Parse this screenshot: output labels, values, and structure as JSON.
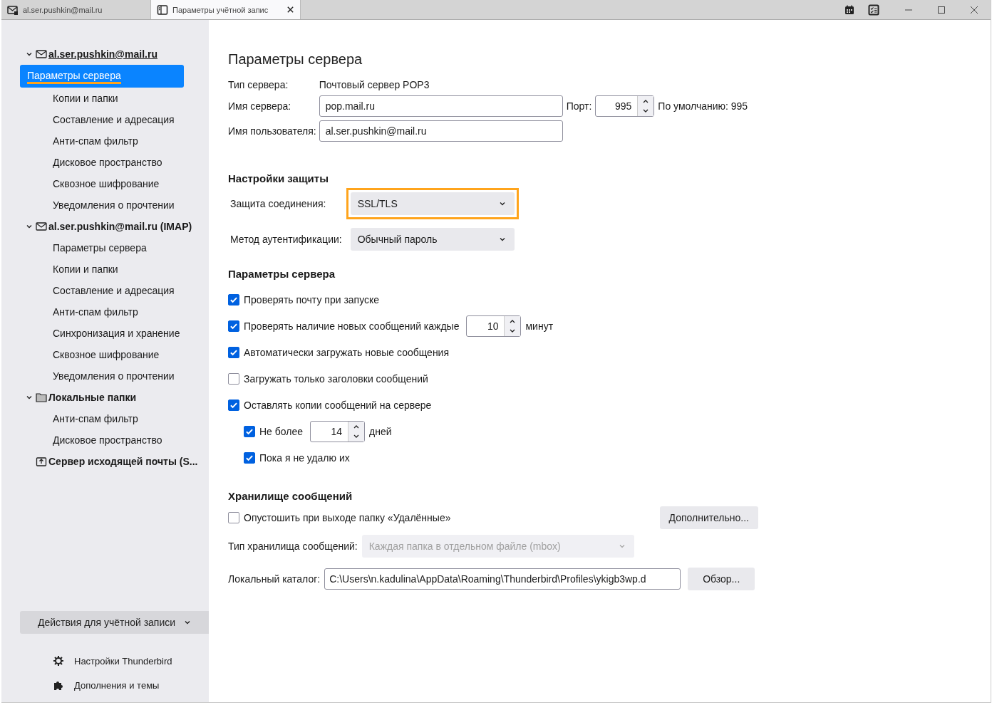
{
  "tabs": [
    {
      "label": "al.ser.pushkin@mail.ru",
      "selected": false
    },
    {
      "label": "Параметры учётной запис",
      "selected": true
    }
  ],
  "sidebar": {
    "accounts": [
      {
        "label": "al.ser.pushkin@mail.ru",
        "kind": "mail",
        "expanded": true,
        "underlined": true,
        "children": [
          {
            "label": "Параметры сервера",
            "selected": true,
            "highlighted": true
          },
          {
            "label": "Копии и папки",
            "selected": false,
            "highlighted": false
          },
          {
            "label": "Составление и адресация",
            "selected": false,
            "highlighted": false
          },
          {
            "label": "Анти-спам фильтр",
            "selected": false,
            "highlighted": false
          },
          {
            "label": "Дисковое пространство",
            "selected": false,
            "highlighted": false
          },
          {
            "label": "Сквозное шифрование",
            "selected": false,
            "highlighted": false
          },
          {
            "label": "Уведомления о прочтении",
            "selected": false,
            "highlighted": false
          }
        ]
      },
      {
        "label": "al.ser.pushkin@mail.ru (IMAP)",
        "kind": "mail",
        "expanded": true,
        "underlined": false,
        "children": [
          {
            "label": "Параметры сервера",
            "selected": false,
            "highlighted": false
          },
          {
            "label": "Копии и папки",
            "selected": false,
            "highlighted": false
          },
          {
            "label": "Составление и адресация",
            "selected": false,
            "highlighted": false
          },
          {
            "label": "Анти-спам фильтр",
            "selected": false,
            "highlighted": false
          },
          {
            "label": "Синхронизация и хранение",
            "selected": false,
            "highlighted": false
          },
          {
            "label": "Сквозное шифрование",
            "selected": false,
            "highlighted": false
          },
          {
            "label": "Уведомления о прочтении",
            "selected": false,
            "highlighted": false
          }
        ]
      },
      {
        "label": "Локальные папки",
        "kind": "folder",
        "expanded": true,
        "underlined": false,
        "children": [
          {
            "label": "Анти-спам фильтр",
            "selected": false,
            "highlighted": false
          },
          {
            "label": "Дисковое пространство",
            "selected": false,
            "highlighted": false
          }
        ]
      },
      {
        "label": "Сервер исходящей почты (S...",
        "kind": "outgoing",
        "underlined": false
      }
    ],
    "actions_button": "Действия для учётной записи",
    "footer": [
      {
        "label": "Настройки Thunderbird",
        "kind": "gear"
      },
      {
        "label": "Дополнения и темы",
        "kind": "puzzle"
      }
    ]
  },
  "main": {
    "title": "Параметры сервера",
    "server_type_label": "Тип сервера:",
    "server_type": "Почтовый сервер POP3",
    "server_name_label": "Имя сервера:",
    "server_name": "pop.mail.ru",
    "port_label": "Порт:",
    "port": "995",
    "default_port": "По умолчанию: 995",
    "username_label": "Имя пользователя:",
    "username": "al.ser.pushkin@mail.ru",
    "security": {
      "heading": "Настройки защиты",
      "rows": [
        {
          "label": "Защита соединения:",
          "value": "SSL/TLS",
          "highlighted": true
        },
        {
          "label": "Метод аутентификации:",
          "value": "Обычный пароль",
          "highlighted": false
        }
      ]
    },
    "settings": {
      "heading": "Параметры сервера",
      "options": [
        {
          "kind": "checkbox",
          "label": "Проверять почту при запуске",
          "checked": true
        },
        {
          "kind": "spin",
          "label": "Проверять наличие новых сообщений каждые",
          "checked": true,
          "value": "10",
          "unit": "минут"
        },
        {
          "kind": "checkbox",
          "label": "Автоматически загружать новые сообщения",
          "checked": true
        },
        {
          "kind": "checkbox",
          "label": "Загружать только заголовки сообщений",
          "checked": false
        },
        {
          "kind": "checkbox",
          "label": "Оставлять копии сообщений на сервере",
          "checked": true,
          "children": [
            {
              "kind": "spin",
              "label": "Не более",
              "checked": true,
              "value": "14",
              "unit": "дней"
            },
            {
              "kind": "checkbox",
              "label": "Пока я не удалю их",
              "checked": true
            }
          ]
        }
      ]
    },
    "storage": {
      "heading": "Хранилище сообщений",
      "empty_trash": {
        "label": "Опустошить при выходе папку «Удалённые»",
        "checked": false
      },
      "advanced_button": "Дополнительно...",
      "store_type_label": "Тип хранилища сообщений:",
      "store_type": "Каждая папка в отдельном файле (mbox)",
      "store_type_disabled": true,
      "local_dir_label": "Локальный каталог:",
      "local_dir": "C:\\Users\\n.kadulina\\AppData\\Roaming\\Thunderbird\\Profiles\\ykigb3wp.d",
      "browse_button": "Обзор..."
    }
  }
}
